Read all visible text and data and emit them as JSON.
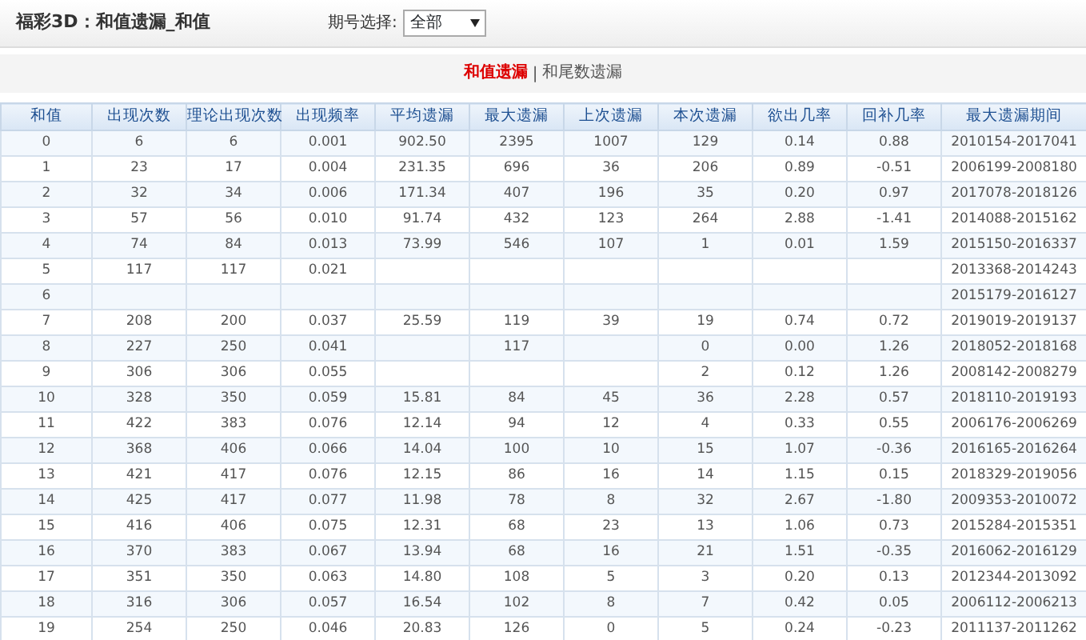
{
  "header": {
    "title": "福彩3D：和值遗漏_和值",
    "period_label": "期号选择:",
    "period_select": {
      "value": "全部"
    }
  },
  "tabs": [
    {
      "label": "和值遗漏",
      "selected": true
    },
    {
      "label": "和尾数遗漏",
      "selected": false
    }
  ],
  "tab_separator": "|",
  "table": {
    "columns": [
      "和值",
      "出现次数",
      "理论出现次数",
      "出现频率",
      "平均遗漏",
      "最大遗漏",
      "上次遗漏",
      "本次遗漏",
      "欲出几率",
      "回补几率",
      "最大遗漏期间"
    ],
    "rows": [
      [
        "0",
        "6",
        "6",
        "0.001",
        "902.50",
        "2395",
        "1007",
        "129",
        "0.14",
        "0.88",
        "2010154-2017041"
      ],
      [
        "1",
        "23",
        "17",
        "0.004",
        "231.35",
        "696",
        "36",
        "206",
        "0.89",
        "-0.51",
        "2006199-2008180"
      ],
      [
        "2",
        "32",
        "34",
        "0.006",
        "171.34",
        "407",
        "196",
        "35",
        "0.20",
        "0.97",
        "2017078-2018126"
      ],
      [
        "3",
        "57",
        "56",
        "0.010",
        "91.74",
        "432",
        "123",
        "264",
        "2.88",
        "-1.41",
        "2014088-2015162"
      ],
      [
        "4",
        "74",
        "84",
        "0.013",
        "73.99",
        "546",
        "107",
        "1",
        "0.01",
        "1.59",
        "2015150-2016337"
      ],
      [
        "5",
        "117",
        "117",
        "0.021",
        null,
        null,
        null,
        null,
        null,
        null,
        "2013368-2014243"
      ],
      [
        "6",
        null,
        null,
        null,
        null,
        null,
        null,
        null,
        null,
        null,
        "2015179-2016127"
      ],
      [
        "7",
        "208",
        "200",
        "0.037",
        "25.59",
        "119",
        "39",
        "19",
        "0.74",
        "0.72",
        "2019019-2019137"
      ],
      [
        "8",
        "227",
        "250",
        "0.041",
        null,
        "117",
        null,
        "0",
        "0.00",
        "1.26",
        "2018052-2018168"
      ],
      [
        "9",
        "306",
        "306",
        "0.055",
        null,
        null,
        null,
        "2",
        "0.12",
        "1.26",
        "2008142-2008279"
      ],
      [
        "10",
        "328",
        "350",
        "0.059",
        "15.81",
        "84",
        "45",
        "36",
        "2.28",
        "0.57",
        "2018110-2019193"
      ],
      [
        "11",
        "422",
        "383",
        "0.076",
        "12.14",
        "94",
        "12",
        "4",
        "0.33",
        "0.55",
        "2006176-2006269"
      ],
      [
        "12",
        "368",
        "406",
        "0.066",
        "14.04",
        "100",
        "10",
        "15",
        "1.07",
        "-0.36",
        "2016165-2016264"
      ],
      [
        "13",
        "421",
        "417",
        "0.076",
        "12.15",
        "86",
        "16",
        "14",
        "1.15",
        "0.15",
        "2018329-2019056"
      ],
      [
        "14",
        "425",
        "417",
        "0.077",
        "11.98",
        "78",
        "8",
        "32",
        "2.67",
        "-1.80",
        "2009353-2010072"
      ],
      [
        "15",
        "416",
        "406",
        "0.075",
        "12.31",
        "68",
        "23",
        "13",
        "1.06",
        "0.73",
        "2015284-2015351"
      ],
      [
        "16",
        "370",
        "383",
        "0.067",
        "13.94",
        "68",
        "16",
        "21",
        "1.51",
        "-0.35",
        "2016062-2016129"
      ],
      [
        "17",
        "351",
        "350",
        "0.063",
        "14.80",
        "108",
        "5",
        "3",
        "0.20",
        "0.13",
        "2012344-2013092"
      ],
      [
        "18",
        "316",
        "306",
        "0.057",
        "16.54",
        "102",
        "8",
        "7",
        "0.42",
        "0.05",
        "2006112-2006213"
      ],
      [
        "19",
        "254",
        "250",
        "0.046",
        "20.83",
        "126",
        "0",
        "5",
        "0.24",
        "-0.23",
        "2011137-2011262"
      ]
    ]
  }
}
